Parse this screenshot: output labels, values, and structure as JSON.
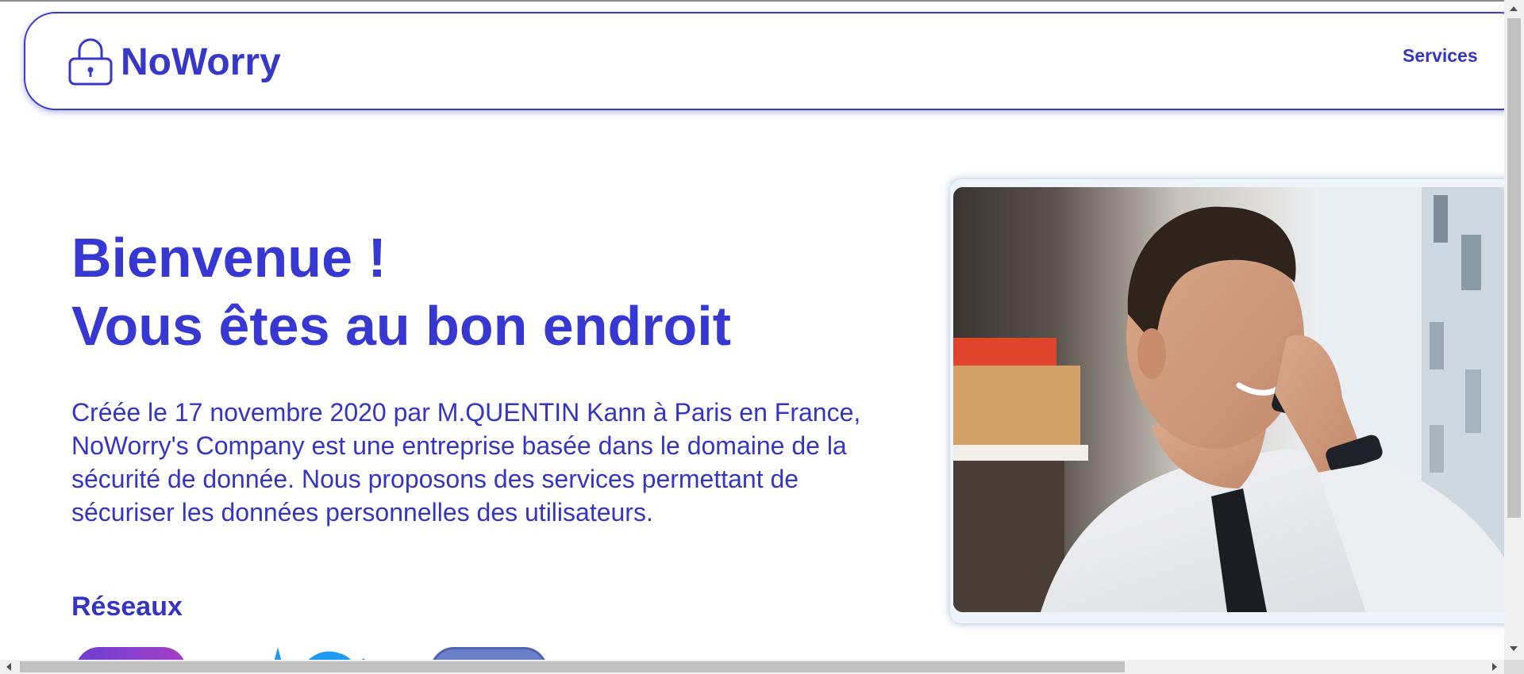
{
  "brand": {
    "name": "NoWorry",
    "logo_icon": "padlock-icon",
    "accent_color": "#3737d2"
  },
  "nav": {
    "services_label": "Services"
  },
  "hero": {
    "title_line1": "Bienvenue !",
    "title_line2": "Vous êtes au bon endroit",
    "description": "Créée le 17 novembre 2020 par M.QUENTIN Kann à Paris en France, NoWorry's Company est une entreprise basée dans le domaine de la sécurité de donnée. Nous proposons des services permettant de sécuriser les données personnelles des utilisateurs."
  },
  "social": {
    "heading": "Réseaux",
    "items": [
      {
        "icon": "instagram-icon"
      },
      {
        "icon": "twitter-icon"
      },
      {
        "icon": "linkedin-icon"
      }
    ]
  },
  "photo": {
    "subject": "man-on-phone-photo"
  }
}
